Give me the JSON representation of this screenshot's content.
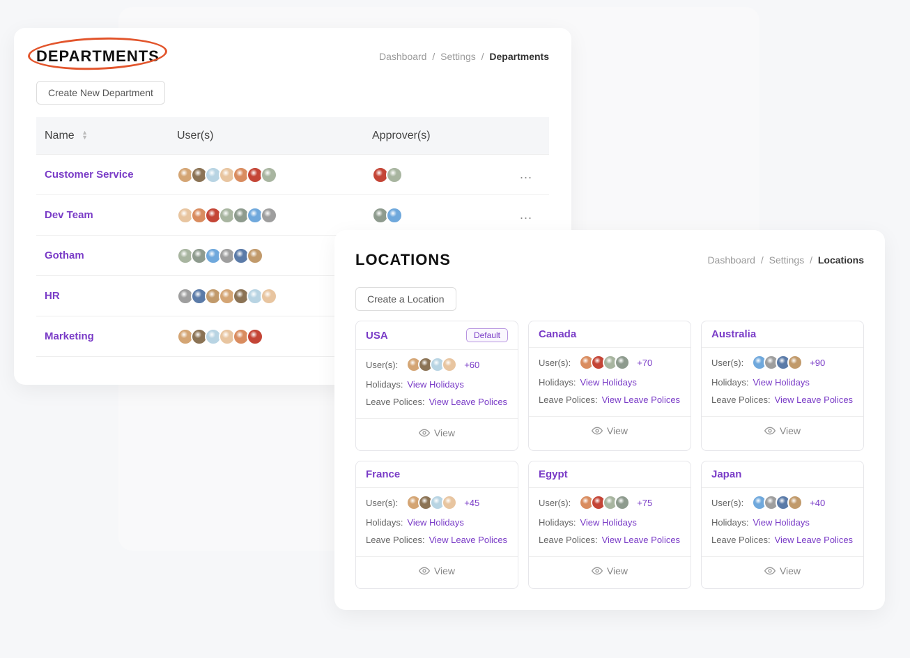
{
  "departments": {
    "title": "DEPARTMENTS",
    "breadcrumb": {
      "a": "Dashboard",
      "b": "Settings",
      "current": "Departments"
    },
    "create_btn": "Create New Department",
    "columns": {
      "name": "Name",
      "users": "User(s)",
      "approvers": "Approver(s)"
    },
    "rows": [
      {
        "name": "Customer Service",
        "user_count": 7,
        "approver_count": 2,
        "actions": "..."
      },
      {
        "name": "Dev Team",
        "user_count": 7,
        "approver_count": 2,
        "actions": "..."
      },
      {
        "name": "Gotham",
        "user_count": 6,
        "approver_count": 0,
        "actions": ""
      },
      {
        "name": "HR",
        "user_count": 7,
        "approver_count": 0,
        "actions": ""
      },
      {
        "name": "Marketing",
        "user_count": 6,
        "approver_count": 0,
        "actions": ""
      }
    ]
  },
  "locations": {
    "title": "LOCATIONS",
    "breadcrumb": {
      "a": "Dashboard",
      "b": "Settings",
      "current": "Locations"
    },
    "create_btn": "Create a Location",
    "default_label": "Default",
    "labels": {
      "users": "User(s):",
      "holidays": "Holidays:",
      "leave": "Leave Polices:",
      "view_holidays": "View Holidays",
      "view_leave": "View Leave Polices",
      "view": "View"
    },
    "cards": [
      {
        "name": "USA",
        "default": true,
        "plus": "+60"
      },
      {
        "name": "Canada",
        "default": false,
        "plus": "+70"
      },
      {
        "name": "Australia",
        "default": false,
        "plus": "+90"
      },
      {
        "name": "France",
        "default": false,
        "plus": "+45"
      },
      {
        "name": "Egypt",
        "default": false,
        "plus": "+75"
      },
      {
        "name": "Japan",
        "default": false,
        "plus": "+40"
      }
    ]
  },
  "avatar_colors": [
    "#d4a574",
    "#8b7355",
    "#b8d4e3",
    "#e8c5a0",
    "#d98c5f",
    "#c44536",
    "#a8b5a0",
    "#8e9b8e",
    "#6fa8dc",
    "#9e9e9e",
    "#5b7ba8",
    "#c19a6b"
  ]
}
